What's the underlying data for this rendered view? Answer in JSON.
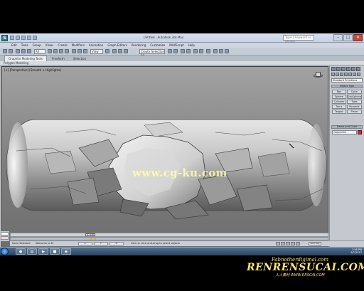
{
  "window": {
    "app_logo": "S",
    "title": "Untitled - Autodesk 3ds Max",
    "search_placeholder": "Type a keyword or phrase",
    "min": "–",
    "max": "□",
    "close": "✕"
  },
  "menubar": [
    "Edit",
    "Tools",
    "Group",
    "Views",
    "Create",
    "Modifiers",
    "Animation",
    "Graph Editors",
    "Rendering",
    "Customize",
    "MAXScript",
    "Help"
  ],
  "toolbar": {
    "selection_filter": "All",
    "view_coord": "View",
    "named_selection": "Create Selection Se"
  },
  "ribbon": {
    "tabs": [
      "Graphite Modeling Tools",
      "Freeform",
      "Selection"
    ],
    "active_tab": "Graphite Modeling Tools",
    "sub_label": "Polygon Modeling"
  },
  "viewport": {
    "label": "[+] [Perspective] [Smooth + Highlights]",
    "watermark": "www.cg-ku.com"
  },
  "command_panel": {
    "category": "Standard Primitives",
    "object_type_header": "Object Type",
    "object_types": [
      "Box",
      "Cone",
      "Sphere",
      "GeoSphere",
      "Cylinder",
      "Tube",
      "Torus",
      "Pyramid",
      "Teapot",
      "Plane"
    ],
    "name_color_header": "Name and Color",
    "object_name": "Object001"
  },
  "timeline": {
    "frame": "0 / 100"
  },
  "status": {
    "selection": "None Selected",
    "prompt": "Click or click-and-drag to select objects",
    "welcome": "Welcome to M",
    "x": "X:",
    "y": "Y:",
    "z": "Z:",
    "autokey": "Auto Key"
  },
  "taskbar": {
    "time": "1:56 PM",
    "date": "9/2/2013"
  },
  "promo": {
    "url": "Fabnotherdigimal.com",
    "brand": "RENRENSUCAI.COM",
    "tag": "人人素材  WWW.RRSCAI.COM"
  },
  "colors": {
    "viewport_bg": "#8f8f8f",
    "panel_bg": "#c5c9cf",
    "object_color": "#c8302a",
    "taskbar": "#2b4560",
    "watermark": "#ffffaa"
  }
}
